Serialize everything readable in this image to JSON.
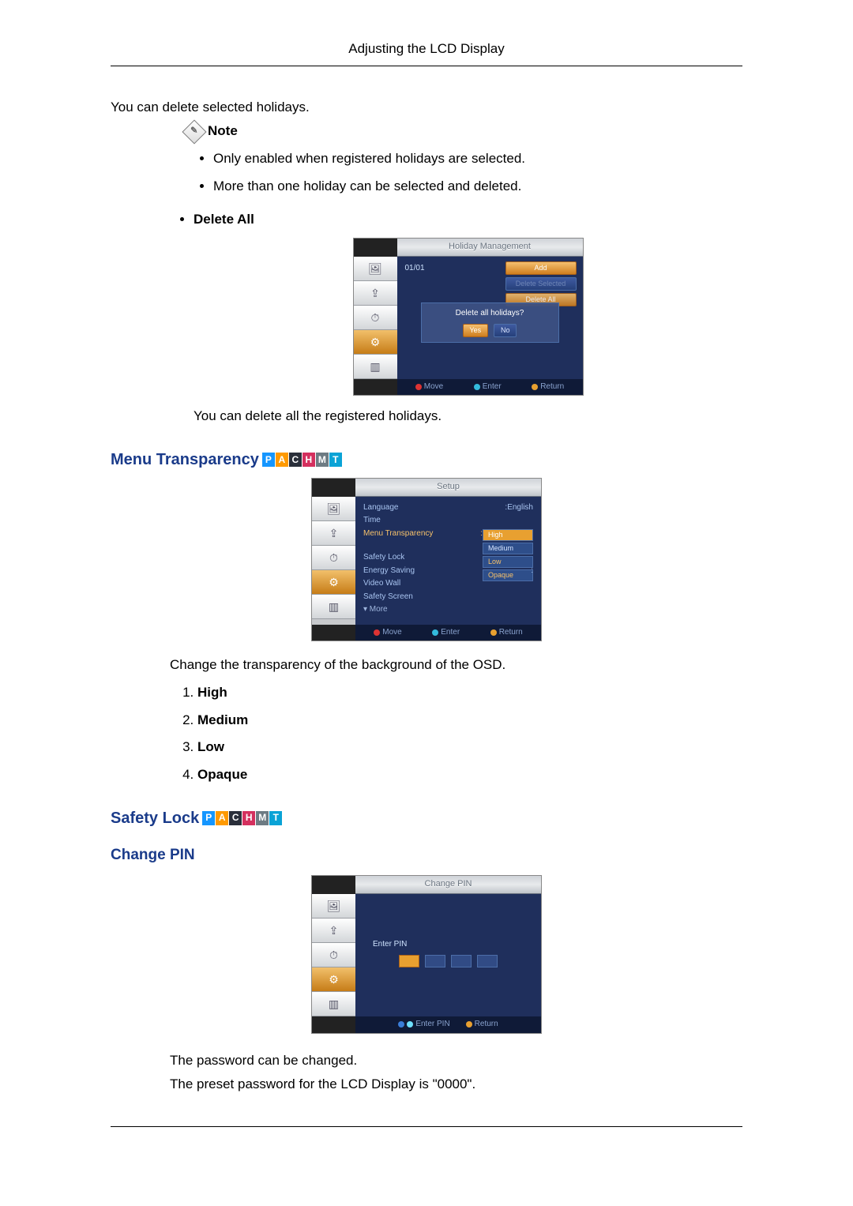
{
  "header": "Adjusting the LCD Display",
  "delete_selected_intro": "You can delete selected holidays.",
  "note_label": "Note",
  "note_bullets": [
    "Only enabled when registered holidays are selected.",
    "More than one holiday can be selected and deleted."
  ],
  "delete_all_label": "Delete All",
  "delete_all_desc": "You can delete all the registered holidays.",
  "osd_holiday": {
    "title": "Holiday Management",
    "date": "01/01",
    "buttons": {
      "add": "Add",
      "del_sel": "Delete Selected",
      "del_all": "Delete All"
    },
    "dialog": {
      "question": "Delete all holidays?",
      "yes": "Yes",
      "no": "No"
    },
    "footer": {
      "move": "Move",
      "enter": "Enter",
      "return": "Return"
    }
  },
  "section_menu_transparency": "Menu Transparency",
  "osd_setup": {
    "title": "Setup",
    "items": {
      "language_l": "Language",
      "language_v": "English",
      "time_l": "Time",
      "mt_l": "Menu Transparency",
      "sl_l": "Safety Lock",
      "es_l": "Energy Saving",
      "vw_l": "Video Wall",
      "ss_l": "Safety Screen",
      "more": "▾ More"
    },
    "opts": {
      "high": "High",
      "medium": "Medium",
      "low": "Low",
      "opaque": "Opaque"
    },
    "footer": {
      "move": "Move",
      "enter": "Enter",
      "return": "Return"
    }
  },
  "mt_desc": "Change the transparency of the background of the OSD.",
  "mt_list": [
    "High",
    "Medium",
    "Low",
    "Opaque"
  ],
  "section_safety_lock": "Safety Lock",
  "section_change_pin": "Change PIN",
  "osd_pin": {
    "title": "Change PIN",
    "enter": "Enter PIN",
    "footer": {
      "enterpin": "Enter PIN",
      "return": "Return"
    }
  },
  "pin_desc1": "The password can be changed.",
  "pin_desc2": "The preset password for the LCD Display is \"0000\"."
}
